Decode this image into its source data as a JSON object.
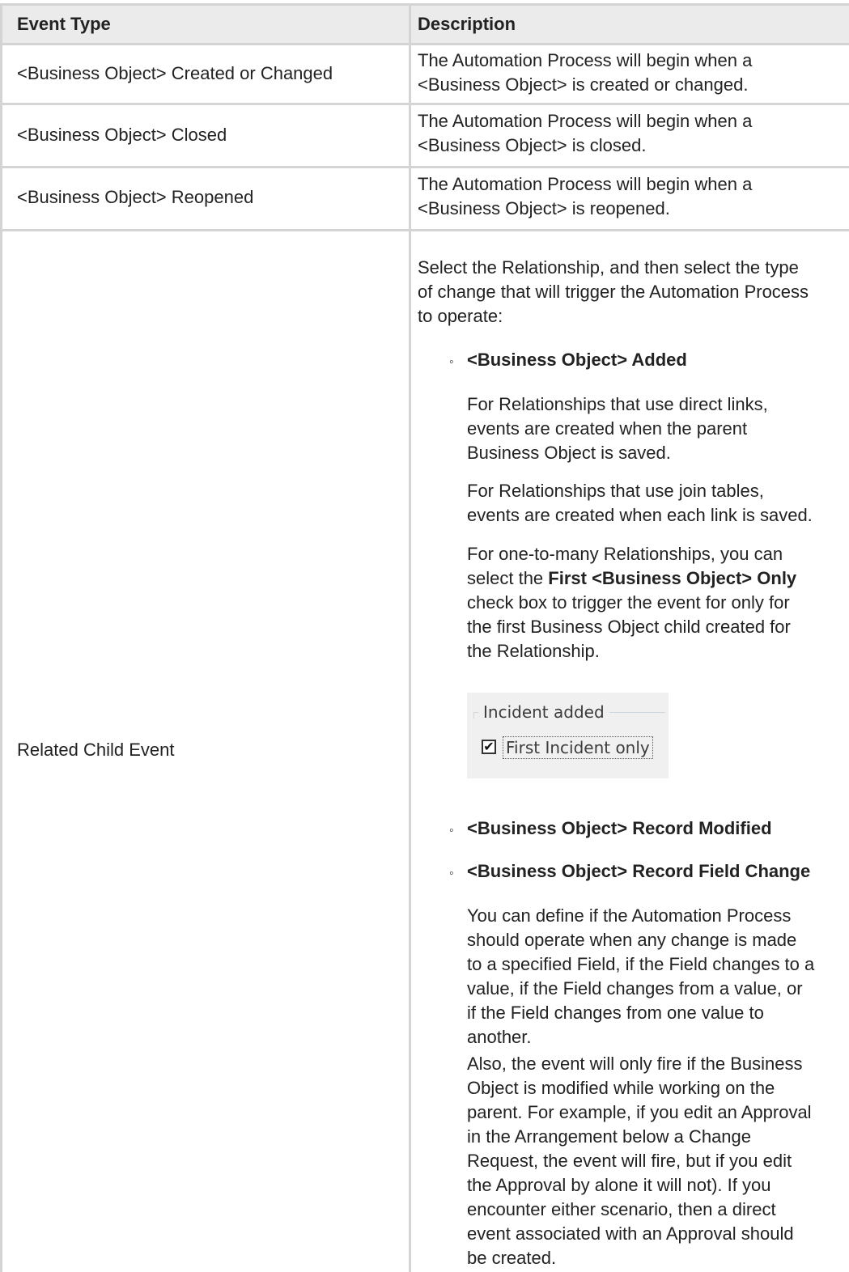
{
  "table": {
    "headers": {
      "event_type": "Event Type",
      "description": "Description"
    },
    "rows": [
      {
        "event": "<Business Object> Created or Changed",
        "desc_line1": "The Automation Process will begin when a",
        "desc_line2": "<Business Object> is created or changed."
      },
      {
        "event": "<Business Object> Closed",
        "desc_line1": "The Automation Process will begin when a",
        "desc_line2": "<Business Object> is closed."
      },
      {
        "event": "<Business Object> Reopened",
        "desc_line1": "The Automation Process will begin when a",
        "desc_line2": "<Business Object> is reopened."
      }
    ],
    "related": {
      "event": "Related Child Event",
      "intro": [
        "Select the Relationship, and then select the type",
        "of change that will trigger the Automation Process",
        "to operate:"
      ],
      "added": {
        "title": "<Business Object> Added",
        "para1": [
          "For Relationships that use direct links,",
          "events are created when the parent",
          "Business Object is saved."
        ],
        "para2": [
          "For Relationships that use join tables,",
          "events are created when each link is saved."
        ],
        "para3_l1": "For one-to-many Relationships, you can",
        "para3_l2_pre": "select the ",
        "para3_l2_bold": "First <Business Object> Only",
        "para3_l3_bold": "check box",
        "para3_l3_post": " to trigger the event for only for",
        "para3_rest": [
          "the first Business Object child created for",
          "the Relationship."
        ]
      },
      "screenshot": {
        "group_label": "Incident added",
        "checkbox_label": "First Incident only",
        "checked": true
      },
      "record_modified": "<Business Object> Record Modified",
      "field_change": {
        "title": "<Business Object> Record Field Change",
        "para1": [
          "You can define if the Automation Process",
          "should operate when any change is made",
          "to a specified Field, if the Field changes to a",
          "value, if the Field changes from a value, or",
          "if the Field changes from one value to",
          "another."
        ],
        "para2": [
          "Also, the event will only fire if the Business",
          "Object is modified while working on the",
          "parent. For example, if you edit an Approval",
          "in the Arrangement below a Change",
          "Request, the event will fire, but if you edit",
          "the Approval by alone it will not). If you",
          "encounter either scenario, then a direct",
          "event associated with an Approval should",
          "be created."
        ]
      }
    }
  }
}
